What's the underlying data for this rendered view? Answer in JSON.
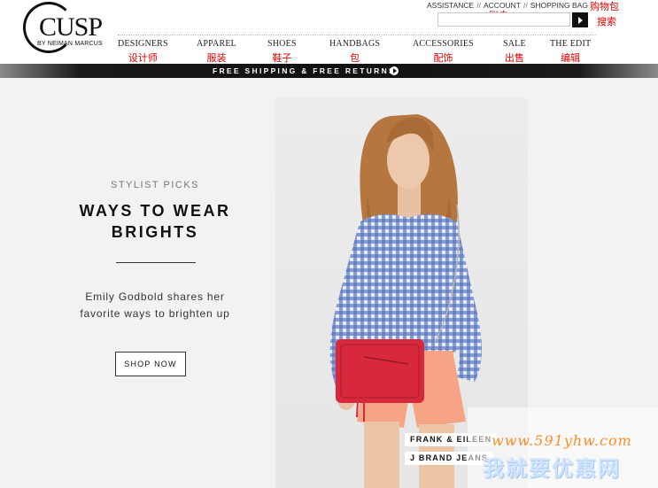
{
  "header": {
    "logo_word": "CUSP",
    "logo_sub": "BY NEIMAN MARCUS",
    "utility": {
      "assistance": "ASSISTANCE",
      "account": "ACCOUNT",
      "shopping_bag": "SHOPPING BAG",
      "separator": "//"
    },
    "cn_labels": {
      "shopping_bag": "购物包",
      "account": "账户",
      "search": "搜索"
    },
    "search": {
      "value": "",
      "placeholder": ""
    }
  },
  "nav": [
    {
      "label": "DESIGNERS",
      "cn": "设计师"
    },
    {
      "label": "APPAREL",
      "cn": "服装"
    },
    {
      "label": "SHOES",
      "cn": "鞋子"
    },
    {
      "label": "HANDBAGS",
      "cn": "包"
    },
    {
      "label": "ACCESSORIES",
      "cn": "配饰"
    },
    {
      "label": "SALE",
      "cn": "出售"
    },
    {
      "label": "THE EDIT",
      "cn": "编辑"
    }
  ],
  "promo": {
    "text": "FREE SHIPPING & FREE RETURNS",
    "icon": "play-circle-icon"
  },
  "hero": {
    "eyebrow": "STYLIST PICKS",
    "headline_line1": "WAYS TO WEAR",
    "headline_line2": "BRIGHTS",
    "desc_line1": "Emily Godbold shares her",
    "desc_line2": "favorite ways to brighten up",
    "cta": "SHOP NOW",
    "credits": [
      "FRANK & EILEEN",
      "J BRAND JEANS"
    ]
  },
  "watermark": {
    "url": "www.591yhw.com",
    "cn": "我就要优惠网"
  },
  "colors": {
    "accent_red": "#e00000",
    "promo_bar": "#111111",
    "background": "#f2f2f2"
  }
}
